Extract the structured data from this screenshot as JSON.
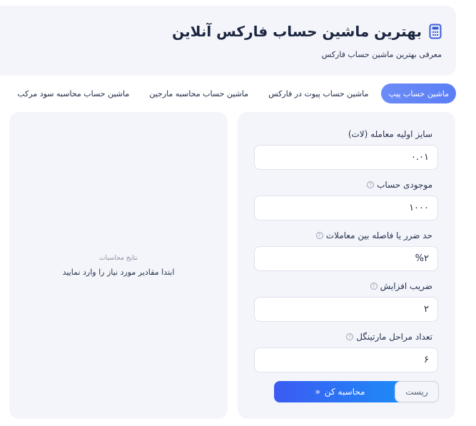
{
  "header": {
    "title": "بهترین ماشین حساب فارکس آنلاین",
    "subtitle": "معرفی بهترین ماشین حساب فارکس",
    "icon": "calculator-icon"
  },
  "tabs": [
    {
      "label": "ماشین حساب پیپ",
      "active": true
    },
    {
      "label": "ماشین حساب پیوت در فارکس",
      "active": false
    },
    {
      "label": "ماشین حساب محاسبه مارجین",
      "active": false
    },
    {
      "label": "ماشین حساب محاسبه سود مرکب",
      "active": false
    }
  ],
  "form": {
    "lot_size": {
      "label": "سایز اولیه معامله (لات)",
      "value": "۰.۰۱"
    },
    "balance": {
      "label": "موجودی حساب",
      "value": "۱۰۰۰"
    },
    "stop_distance": {
      "label": "حد ضرر یا فاصله بین معاملات",
      "value": "%۲"
    },
    "multiplier": {
      "label": "ضریب افزایش",
      "value": "۲"
    },
    "steps": {
      "label": "تعداد مراحل مارتینگل",
      "value": "۶"
    },
    "calc_button": "محاسبه کن",
    "calc_arrow": "«",
    "reset_button": "ریست"
  },
  "result": {
    "title": "نتایج محاسبات",
    "message": "ابتدا مقادیر مورد نیاز را وارد نمایید"
  },
  "colors": {
    "accent": "#5a7ef5",
    "button_gradient_start": "#3b5bf2",
    "button_gradient_end": "#1d8cf7",
    "card_bg": "#f3f5fa"
  }
}
